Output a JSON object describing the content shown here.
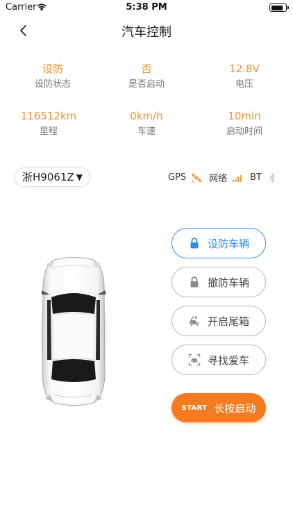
{
  "status_bar": {
    "carrier": "Carrier",
    "time": "5:38 PM",
    "battery_level": 0.85
  },
  "nav": {
    "back_icon": "chevron-left-icon",
    "title": "汽车控制"
  },
  "stats": [
    {
      "value": "设防",
      "label": "设防状态"
    },
    {
      "value": "否",
      "label": "是否启动"
    },
    {
      "value": "12.8V",
      "label": "电压"
    },
    {
      "value": "116512km",
      "label": "里程"
    },
    {
      "value": "0km/h",
      "label": "车速"
    },
    {
      "value": "10min",
      "label": "启动时间"
    }
  ],
  "plate": {
    "number": "浙H9061Z",
    "caret": "▼"
  },
  "indicators": [
    {
      "label": "GPS",
      "icon": "satellite-icon",
      "color": "#f0922b"
    },
    {
      "label": "网络",
      "icon": "signal-bars-icon",
      "color": "#f0922b"
    },
    {
      "label": "BT",
      "icon": "bluetooth-icon",
      "color": "#c8c8c8"
    }
  ],
  "actions": [
    {
      "label": "设防车辆",
      "icon": "lock-icon",
      "active": true
    },
    {
      "label": "撤防车辆",
      "icon": "lock-icon",
      "active": false
    },
    {
      "label": "开启尾箱",
      "icon": "trunk-icon",
      "active": false
    },
    {
      "label": "寻找爱车",
      "icon": "find-car-icon",
      "active": false
    }
  ],
  "start_button": {
    "tag": "START",
    "label": "长按启动"
  },
  "colors": {
    "accent_orange": "#f0922b",
    "start_orange": "#f47b20",
    "active_blue": "#2e8ef0",
    "inactive_gray": "#b5b5b5"
  }
}
